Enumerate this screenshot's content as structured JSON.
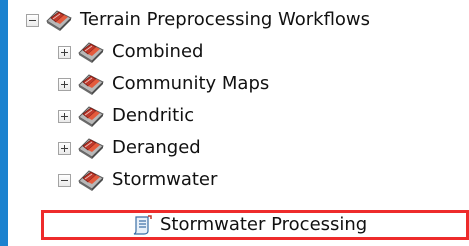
{
  "tree": {
    "root": {
      "label": "Terrain Preprocessing Workflows",
      "expanded": true,
      "icon": "toolbox-icon"
    },
    "children": [
      {
        "label": "Combined",
        "expanded": false,
        "icon": "toolbox-icon"
      },
      {
        "label": "Community Maps",
        "expanded": false,
        "icon": "toolbox-icon"
      },
      {
        "label": "Dendritic",
        "expanded": false,
        "icon": "toolbox-icon"
      },
      {
        "label": "Deranged",
        "expanded": false,
        "icon": "toolbox-icon"
      },
      {
        "label": "Stormwater",
        "expanded": true,
        "icon": "toolbox-icon"
      }
    ],
    "stormwater_children": [
      {
        "label": "Stormwater Processing",
        "icon": "script-tool-icon",
        "highlighted": true
      }
    ]
  },
  "colors": {
    "background": "#1b82cf",
    "panel": "#ffffff",
    "highlight_border": "#ee2b2b"
  }
}
